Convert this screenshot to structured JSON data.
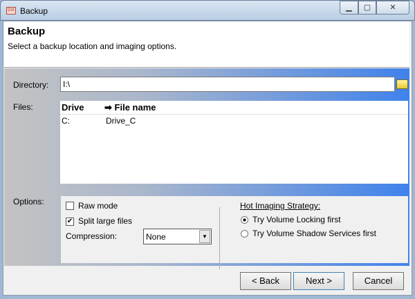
{
  "window": {
    "title": "Backup",
    "icon_text": "DiX"
  },
  "header": {
    "title": "Backup",
    "subtitle": "Select a backup location and imaging options."
  },
  "directory": {
    "label": "Directory:",
    "value": "I:\\"
  },
  "files": {
    "label": "Files:",
    "columns": [
      "Drive",
      "File name"
    ],
    "rows": [
      {
        "drive": "C:",
        "file": "Drive_C"
      }
    ]
  },
  "options": {
    "label": "Options:",
    "raw_mode": {
      "label": "Raw mode",
      "checked": false
    },
    "split": {
      "label": "Split large files",
      "checked": true
    },
    "compression_label": "Compression:",
    "compression_value": "None",
    "strategy_label": "Hot Imaging Strategy:",
    "strategy_options": [
      "Try Volume Locking first",
      "Try Volume Shadow Services first"
    ],
    "strategy_selected": 0
  },
  "buttons": {
    "back": "< Back",
    "next": "Next >",
    "cancel": "Cancel"
  }
}
